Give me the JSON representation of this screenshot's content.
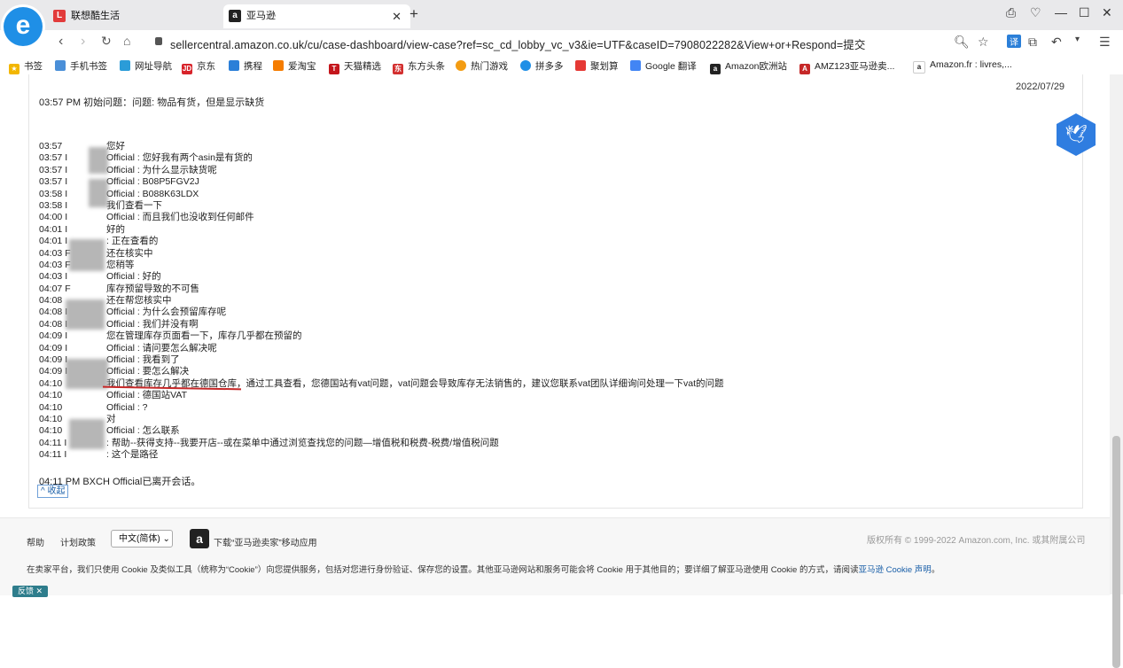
{
  "browser": {
    "tabs": [
      {
        "label": "联想酷生活",
        "favicon": "lenovo-icon"
      },
      {
        "label": "亚马逊",
        "favicon": "amazon-icon"
      }
    ],
    "url": "sellercentral.amazon.co.uk/cu/case-dashboard/view-case?ref=sc_cd_lobby_vc_v3&ie=UTF&caseID=7908022282&View+or+Respond=提交",
    "bookmarks": [
      "书签",
      "手机书签",
      "网址导航",
      "京东",
      "携程",
      "爱淘宝",
      "天猫精选",
      "东方头条",
      "热门游戏",
      "拼多多",
      "聚划算",
      "Google 翻译",
      "Amazon欧洲站",
      "AMZ123亚马逊卖...",
      "Amazon.fr : livres,..."
    ]
  },
  "case": {
    "date": "2022/07/29",
    "initial_issue": "03:57 PM 初始问题：问题: 物品有货，但是显示缺货",
    "messages": [
      {
        "time": "03:57",
        "text": "您好"
      },
      {
        "time": "03:57 I",
        "text": "Official : 您好我有两个asin是有货的"
      },
      {
        "time": "03:57 I",
        "text": "Official : 为什么显示缺货呢"
      },
      {
        "time": "03:57 I",
        "text": "Official : B08P5FGV2J"
      },
      {
        "time": "03:58 I",
        "text": "Official : B088K63LDX"
      },
      {
        "time": "03:58 I",
        "text": "我们查看一下"
      },
      {
        "time": "04:00 I",
        "text": "Official : 而且我们也没收到任何邮件"
      },
      {
        "time": "04:01 I",
        "text": "好的"
      },
      {
        "time": "04:01 I",
        "text": ": 正在查看的"
      },
      {
        "time": "04:03 F",
        "text": "还在核实中"
      },
      {
        "time": "04:03 F",
        "text": "您稍等"
      },
      {
        "time": "04:03 I",
        "text": "Official : 好的"
      },
      {
        "time": "04:07 F",
        "text": "库存预留导致的不可售"
      },
      {
        "time": "04:08",
        "text": "还在帮您核实中"
      },
      {
        "time": "04:08 I",
        "text": "Official : 为什么会预留库存呢"
      },
      {
        "time": "04:08 I",
        "text": "Official : 我们并没有啊"
      },
      {
        "time": "04:09 I",
        "text": "您在管理库存页面看一下，库存几乎都在预留的"
      },
      {
        "time": "04:09 I",
        "text": "Official : 请问要怎么解决呢"
      },
      {
        "time": "04:09 I",
        "text": "Official : 我看到了"
      },
      {
        "time": "04:09 I",
        "text": "Official : 要怎么解决"
      },
      {
        "time": "04:10",
        "text": "我们查看库存几乎都在德国仓库，通过工具查看，您德国站有vat问题，vat问题会导致库存无法销售的，建议您联系vat团队详细询问处理一下vat的问题"
      },
      {
        "time": "04:10",
        "text": "Official : 德国站VAT"
      },
      {
        "time": "04:10",
        "text": "Official : ?"
      },
      {
        "time": "04:10",
        "text": "对"
      },
      {
        "time": "04:10",
        "text": "Official : 怎么联系"
      },
      {
        "time": "04:11 I",
        "text": ": 帮助--获得支持--我要开店--或在菜单中通过浏览查找您的问题—增值税和税费-税费/增值税问题"
      },
      {
        "time": "04:11 I",
        "text": ": 这个是路径"
      }
    ],
    "left_notice": "04:11 PM BXCH Official已离开会话。",
    "collapse_label": "^ 收起"
  },
  "footer": {
    "help": "帮助",
    "policy": "计划政策",
    "language": "中文(简体)",
    "app_label": "下载“亚马逊卖家”移动应用",
    "copyright": "版权所有 © 1999-2022 Amazon.com, Inc. 或其附属公司",
    "cookie_text": "在卖家平台，我们只使用 Cookie 及类似工具（统称为“Cookie”）向您提供服务，包括对您进行身份验证、保存您的设置。其他亚马逊网站和服务可能会将 Cookie 用于其他目的；要详细了解亚马逊使用 Cookie 的方式，请阅读",
    "cookie_link": "亚马逊 Cookie 声明",
    "cookie_end": "。",
    "feedback": "反馈"
  }
}
